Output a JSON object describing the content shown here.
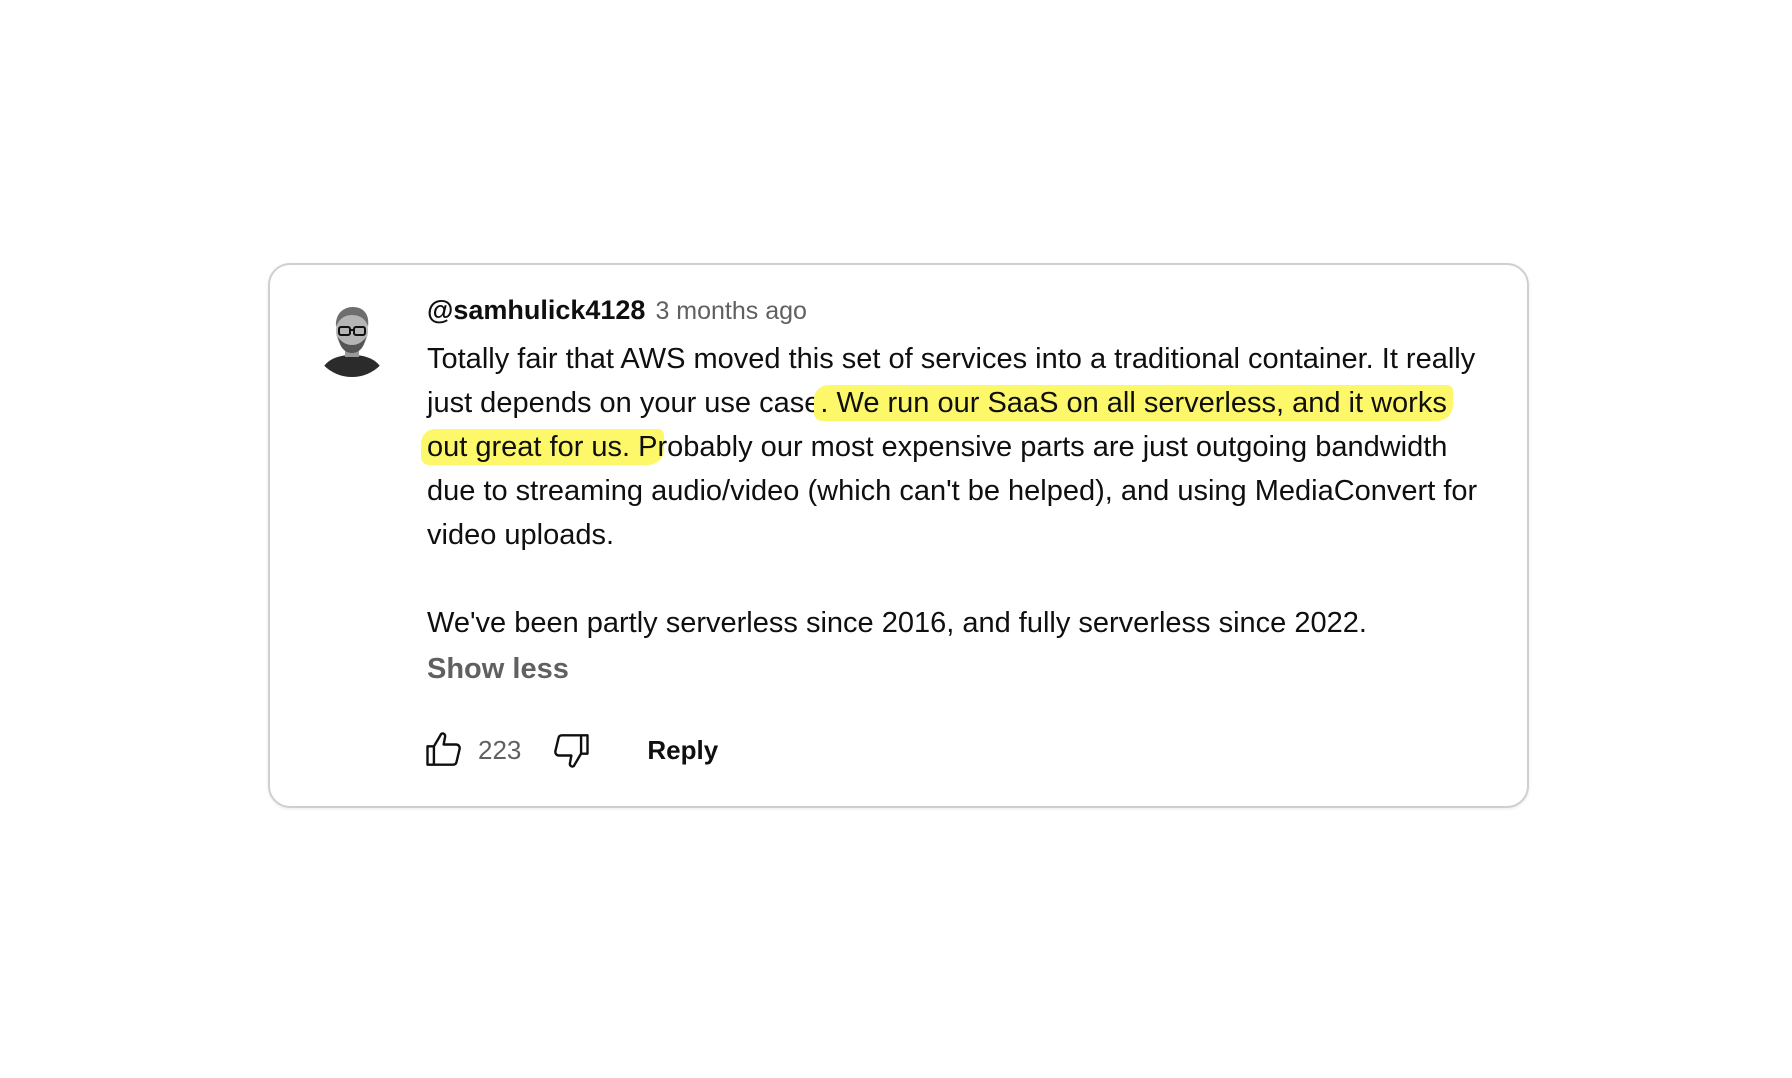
{
  "comment": {
    "author": "@samhulick4128",
    "timestamp": "3 months ago",
    "text_part1": "Totally fair that AWS moved this set of services into a traditional container. It really just depends on your use case",
    "text_highlighted": ". We run our SaaS on all serverless, and it works out great for us. P",
    "text_part2": "robably our most expensive parts are just outgoing bandwidth due to streaming audio/video (which can't be helped), and using MediaConvert for video uploads.",
    "paragraph2": "We've been partly serverless since 2016, and fully serverless since 2022.",
    "show_less_label": "Show less",
    "avatar_icon": "person-avatar-icon"
  },
  "actions": {
    "like_icon": "thumbs-up-icon",
    "like_count": "223",
    "dislike_icon": "thumbs-down-icon",
    "reply_label": "Reply"
  },
  "colors": {
    "highlight": "#fdf86a",
    "secondary_text": "#606060",
    "border": "#cfcfcf"
  }
}
